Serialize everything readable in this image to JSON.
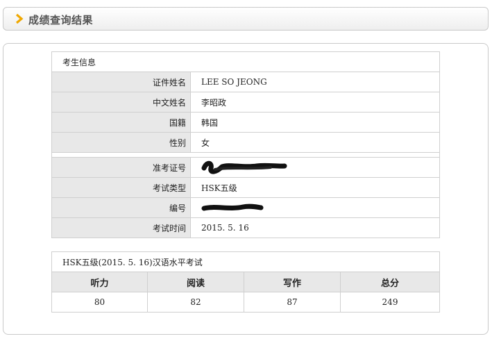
{
  "header": {
    "title": "成绩查询结果"
  },
  "candidate_info": {
    "section_title": "考生信息",
    "rows": [
      {
        "label": "证件姓名",
        "value": "LEE SO JEONG"
      },
      {
        "label": "中文姓名",
        "value": "李昭政"
      },
      {
        "label": "国籍",
        "value": "韩国"
      },
      {
        "label": "性别",
        "value": "女"
      }
    ],
    "exam_rows": [
      {
        "label": "准考证号",
        "value": ""
      },
      {
        "label": "考试类型",
        "value": "HSK五级"
      },
      {
        "label": "编号",
        "value": ""
      },
      {
        "label": "考试时间",
        "value": "2015. 5. 16"
      }
    ]
  },
  "scores": {
    "caption": "HSK五级(2015. 5. 16)汉语水平考试",
    "headers": [
      "听力",
      "阅读",
      "写作",
      "总分"
    ],
    "values": [
      "80",
      "82",
      "87",
      "249"
    ]
  }
}
